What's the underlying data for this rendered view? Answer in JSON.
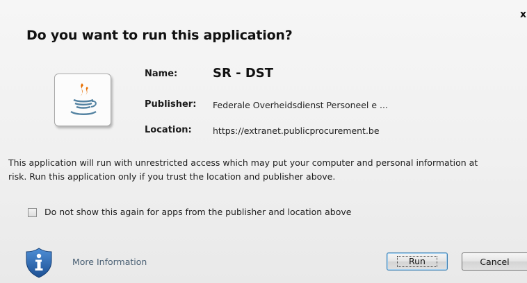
{
  "dialog": {
    "title": "Do you want to run this application?",
    "close_label": "x"
  },
  "app": {
    "icon": "java-icon",
    "name_label": "Name:",
    "name_value": "SR - DST",
    "publisher_label": "Publisher:",
    "publisher_value": "Federale Overheidsdienst Personeel e ...",
    "location_label": "Location:",
    "location_value": "https://extranet.publicprocurement.be"
  },
  "warning": {
    "text": "This application will run with unrestricted access which may put your computer and personal information at risk. Run this application only if you trust the location and publisher above."
  },
  "checkbox": {
    "label": "Do not show this again for apps from the publisher and location above",
    "checked": false
  },
  "footer": {
    "shield_icon": "info-shield-icon",
    "more_info_label": "More Information",
    "run_label": "Run",
    "cancel_label": "Cancel"
  },
  "colors": {
    "link": "#4a6074",
    "shield_blue": "#2b6bb3",
    "java_orange": "#e76f00",
    "java_blue": "#5382a1"
  }
}
